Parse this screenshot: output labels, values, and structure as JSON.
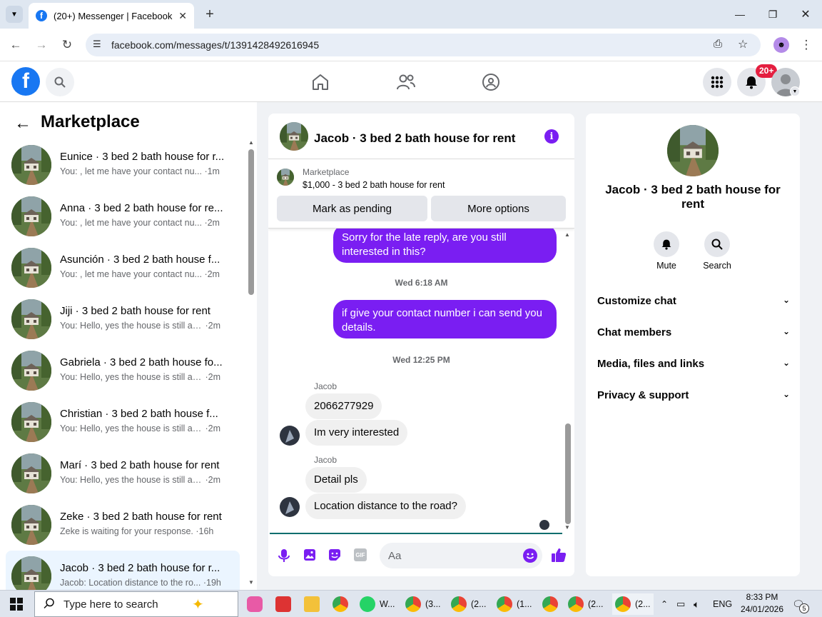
{
  "browser": {
    "tab_title": "(20+) Messenger | Facebook",
    "url": "facebook.com/messages/t/1391428492616945"
  },
  "header": {
    "notification_badge": "20+"
  },
  "sidebar": {
    "title": "Marketplace",
    "conversations": [
      {
        "name": "Eunice · 3 bed 2 bath house for r...",
        "preview": "You: , let me have your contact nu...",
        "time": "1m"
      },
      {
        "name": "Anna · 3 bed 2 bath house for re...",
        "preview": "You: , let me have your contact nu...",
        "time": "2m"
      },
      {
        "name": "Asunción · 3 bed 2 bath house f...",
        "preview": "You: , let me have your contact nu...",
        "time": "2m"
      },
      {
        "name": "Jiji · 3 bed 2 bath house for rent",
        "preview": "You: Hello, yes the house is still av...",
        "time": "2m"
      },
      {
        "name": "Gabriela · 3 bed 2 bath house fo...",
        "preview": "You: Hello, yes the house is still av...",
        "time": "2m"
      },
      {
        "name": "Christian · 3 bed 2 bath house f...",
        "preview": "You: Hello, yes the house is still av...",
        "time": "2m"
      },
      {
        "name": "Marí · 3 bed 2 bath house for rent",
        "preview": "You: Hello, yes the house is still av...",
        "time": "2m"
      },
      {
        "name": "Zeke · 3 bed 2 bath house for rent",
        "preview": "Zeke is waiting for your response.",
        "time": "16h"
      },
      {
        "name": "Jacob · 3 bed 2 bath house for r...",
        "preview": "Jacob: Location distance to the ro...",
        "time": "19h"
      }
    ]
  },
  "chat": {
    "title": "Jacob · 3 bed 2 bath house for rent",
    "listing_source": "Marketplace",
    "listing_price_title": "$1,000 - 3 bed 2 bath house for rent",
    "mark_pending": "Mark as pending",
    "more_options": "More options",
    "msg_out_1": "Sorry for the late reply, are you still interested in this?",
    "time_1": "Wed 6:18 AM",
    "msg_out_2": "if give your contact number  i can send you details.",
    "time_2": "Wed 12:25 PM",
    "sender_1": "Jacob",
    "msg_in_1": "2066277929",
    "msg_in_2": "Im very interested",
    "sender_2": "Jacob",
    "msg_in_3": "Detail pls",
    "msg_in_4": "Location distance to the road?",
    "composer_placeholder": "Aa"
  },
  "details": {
    "title": "Jacob · 3 bed 2 bath house for rent",
    "mute": "Mute",
    "search": "Search",
    "sections": [
      "Customize chat",
      "Chat members",
      "Media, files and links",
      "Privacy & support"
    ]
  },
  "taskbar": {
    "search_placeholder": "Type here to search",
    "items": [
      "W...",
      "(3...",
      "(2...",
      "(1...",
      "(2...",
      "(2..."
    ],
    "lang": "ENG",
    "time": "8:33 PM",
    "date": "24/01/2026",
    "notif_count": "5"
  },
  "colors": {
    "accent": "#7a1ef2",
    "facebook_blue": "#1877f2",
    "badge": "#e41e3f"
  }
}
